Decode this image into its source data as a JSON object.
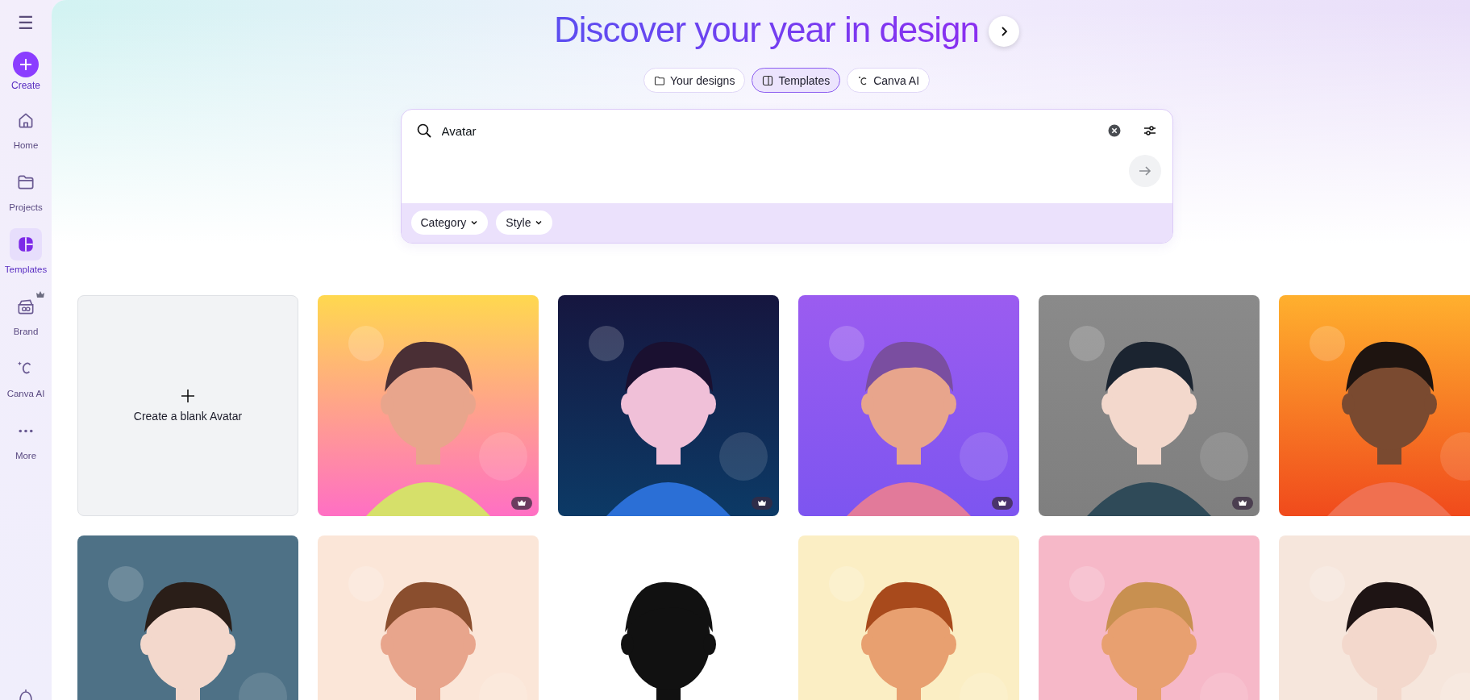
{
  "sidebar": {
    "menu_label": "☰",
    "create": {
      "label": "Create"
    },
    "items": [
      {
        "label": "Home",
        "selected": false,
        "premium": false
      },
      {
        "label": "Projects",
        "selected": false,
        "premium": false
      },
      {
        "label": "Templates",
        "selected": true,
        "premium": false
      },
      {
        "label": "Brand",
        "selected": false,
        "premium": true
      },
      {
        "label": "Canva AI",
        "selected": false,
        "premium": false
      },
      {
        "label": "More",
        "selected": false,
        "premium": false
      }
    ]
  },
  "hero": {
    "title": "Discover your year in design"
  },
  "tabs": [
    {
      "label": "Your designs",
      "selected": false
    },
    {
      "label": "Templates",
      "selected": true
    },
    {
      "label": "Canva AI",
      "selected": false
    }
  ],
  "search": {
    "value": "Avatar"
  },
  "filters": [
    {
      "label": "Category"
    },
    {
      "label": "Style"
    }
  ],
  "blank_card": {
    "label": "Create a blank Avatar"
  },
  "templates": [
    {
      "kind": "picture",
      "premium": true
    },
    {
      "kind": "picture",
      "premium": true
    },
    {
      "kind": "picture",
      "premium": true
    },
    {
      "kind": "picture",
      "premium": true
    },
    {
      "kind": "picture",
      "premium": false
    },
    {
      "kind": "picture",
      "premium": false
    },
    {
      "kind": "picture",
      "premium": false
    },
    {
      "kind": "picture",
      "premium": false
    },
    {
      "kind": "picture",
      "premium": false
    },
    {
      "kind": "picture",
      "premium": false
    },
    {
      "kind": "picture",
      "premium": false
    }
  ]
}
